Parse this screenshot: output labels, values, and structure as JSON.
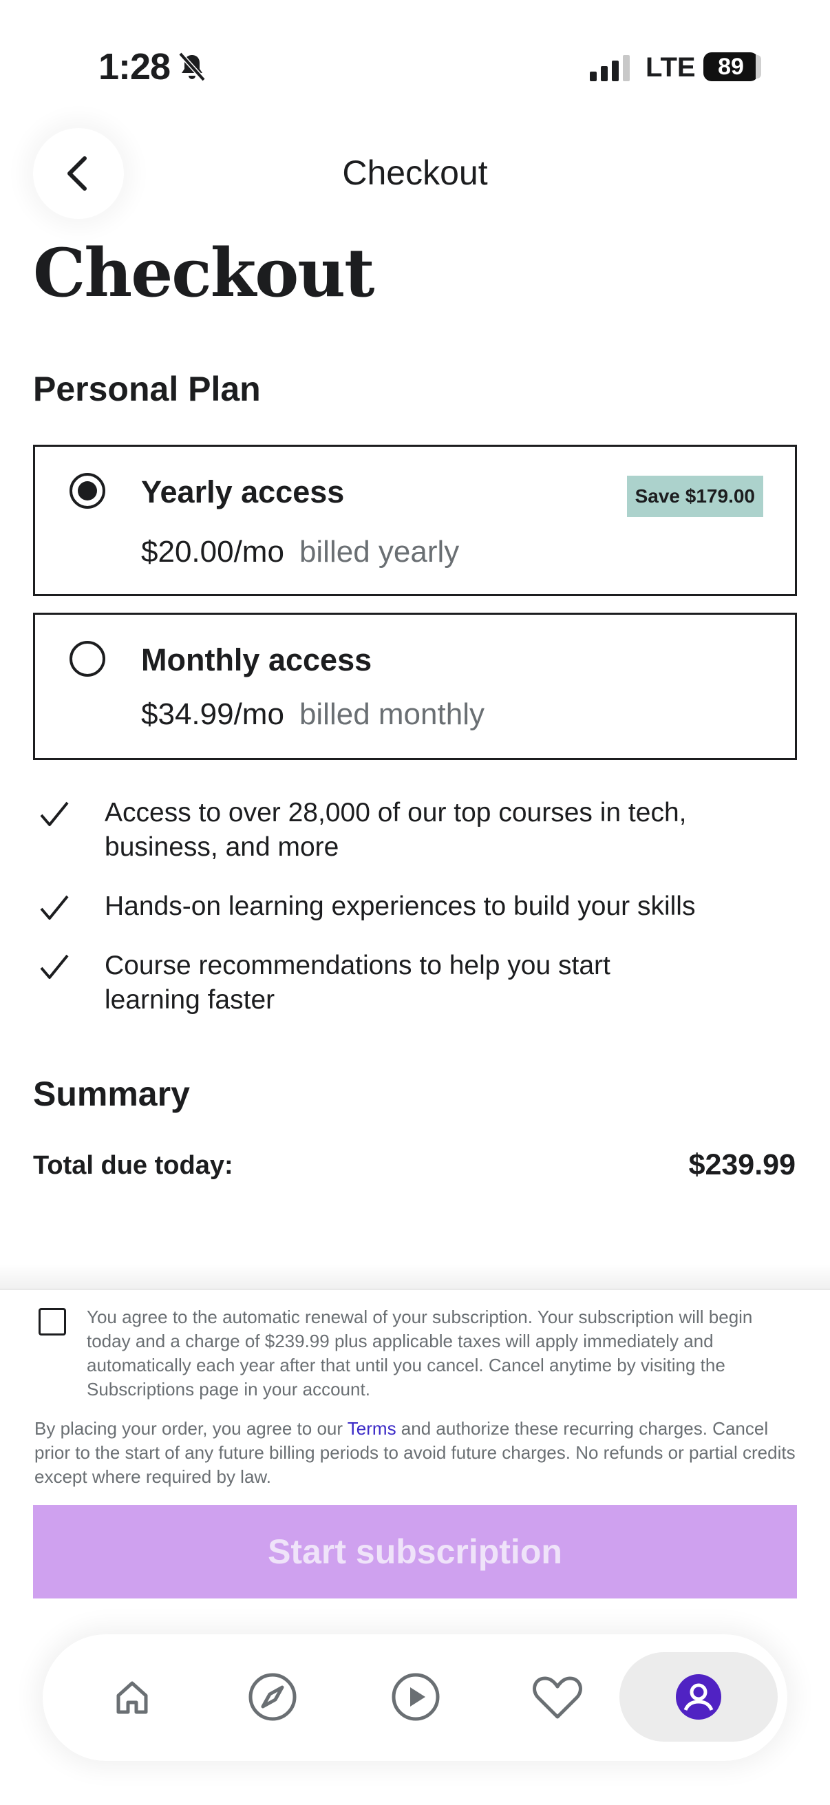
{
  "status_bar": {
    "time": "1:28",
    "network": "LTE",
    "battery": "89"
  },
  "header": {
    "title": "Checkout",
    "back_icon": "chevron-left-icon"
  },
  "page": {
    "title": "Checkout",
    "section_title": "Personal Plan"
  },
  "plans": [
    {
      "name": "Yearly access",
      "price": "$20.00/mo",
      "billing": "billed yearly",
      "badge": "Save $179.00",
      "selected": true
    },
    {
      "name": "Monthly access",
      "price": "$34.99/mo",
      "billing": "billed monthly",
      "selected": false
    }
  ],
  "features": [
    "Access to over 28,000 of our top courses in tech, business, and more",
    "Hands-on learning experiences to build your skills",
    "Course recommendations to help you start learning faster"
  ],
  "summary": {
    "title": "Summary",
    "total_label": "Total due today:",
    "total_value": "$239.99"
  },
  "legal": {
    "agree_text": "You agree to the automatic renewal of your subscription. Your subscription will begin today and a charge of $239.99 plus applicable taxes will apply immediately and automatically each year after that until you cancel. Cancel anytime by visiting the Subscriptions page in your account.",
    "terms_prefix": "By placing your order, you agree to our ",
    "terms_link": "Terms",
    "terms_suffix": " and authorize these recurring charges. Cancel prior to the start of any future billing periods to avoid future charges. No refunds or partial credits except where required by law."
  },
  "cta": {
    "label": "Start subscription",
    "color": "#cfa1ef"
  },
  "tab_bar": {
    "items": [
      "home-icon",
      "compass-icon",
      "play-icon",
      "heart-icon",
      "account-icon"
    ],
    "active": "account-icon",
    "accent": "#5022c3"
  }
}
